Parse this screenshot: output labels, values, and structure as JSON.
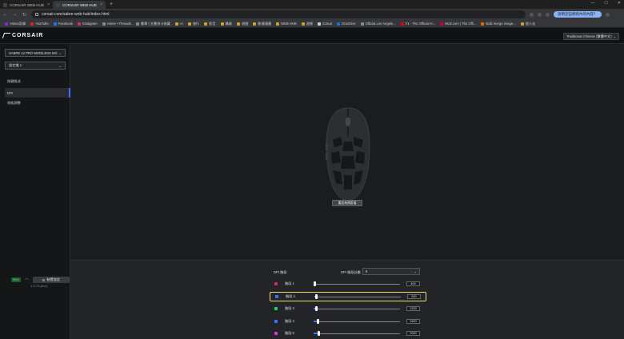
{
  "browser": {
    "tabs": [
      {
        "label": "CORSAIR WEB HUB",
        "active": false
      },
      {
        "label": "CORSAIR WEB HUB",
        "active": true
      }
    ],
    "url": "corsair.com/sabre-web-hub/index.html",
    "translate_prompt": "說明這些網頁內的內容？",
    "bookmarks": [
      "Yahoo奇摩",
      "YouTube",
      "Facebook",
      "Instagram",
      "Home • Threads",
      "書單 | 文書排卡收藏",
      "AI",
      "旅行",
      "影音",
      "購買",
      "遊戲",
      "動漫漫畫",
      "WEB HUB",
      "週報",
      "iCloud",
      "OneDrive",
      "Official Los Angele...",
      "F1 - The Official H...",
      "MLB.com | The Offi...",
      "Bulk merge image...",
      "個人化"
    ]
  },
  "app": {
    "brand": "CORSAIR",
    "language": "Traditional Chinese (繁體中文)",
    "device_select": "SABRE v2 PRO WIRELESS MG",
    "profile_select": "設定檔 1",
    "nav": [
      {
        "label": "按鍵指派",
        "active": false
      },
      {
        "label": "DPI",
        "active": true
      },
      {
        "label": "效能調整",
        "active": false
      }
    ],
    "battery": "99%",
    "device_settings": "裝置設定",
    "version": "1.0.73 (live)",
    "reset_button": "重設為預設值",
    "dpi_stages_label": "DPI 階段",
    "dpi_amount_label": "DPI 階段計數",
    "dpi_amount_value": "5",
    "stages": [
      {
        "label": "階段 1",
        "value": "400",
        "fraction": 0.0,
        "color": "#e0245e",
        "selected": false
      },
      {
        "label": "階段 2",
        "value": "800",
        "fraction": 0.02,
        "color": "#3b73ff",
        "selected": true
      },
      {
        "label": "階段 3",
        "value": "1200",
        "fraction": 0.03,
        "color": "#1fcf6a",
        "selected": false
      },
      {
        "label": "階段 4",
        "value": "1600",
        "fraction": 0.05,
        "color": "#3b73ff",
        "selected": false
      },
      {
        "label": "階段 5",
        "value": "2000",
        "fraction": 0.06,
        "color": "#d63bd6",
        "selected": false
      }
    ]
  }
}
